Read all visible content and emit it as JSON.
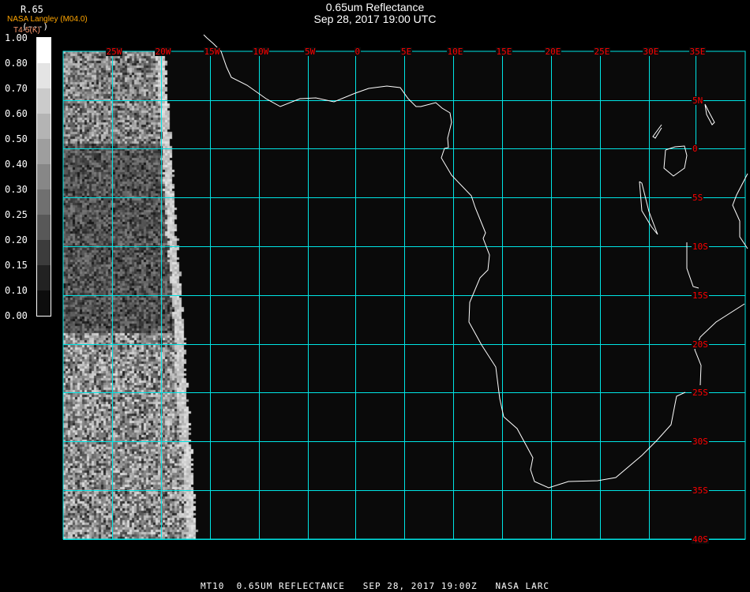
{
  "header": {
    "title": "0.65um Reflectance",
    "subtitle": "Sep 28, 2017 19:00 UTC"
  },
  "overlay_text": {
    "channel": "R.65",
    "units": "(---)",
    "producer": "NASA Langley (M04.0)",
    "secondary": "T4-5(K)"
  },
  "colorbar": {
    "labels": [
      "1.00",
      "0.80",
      "0.70",
      "0.60",
      "0.50",
      "0.40",
      "0.30",
      "0.25",
      "0.20",
      "0.15",
      "0.10",
      "0.00"
    ],
    "colors": [
      "#ffffff",
      "#e4e4e4",
      "#cbcbcb",
      "#b4b4b4",
      "#9e9e9e",
      "#878787",
      "#707070",
      "#585858",
      "#3c3c3c",
      "#222222",
      "#0d0d0d"
    ]
  },
  "map": {
    "longitude_labels": [
      "25W",
      "20W",
      "15W",
      "10W",
      "5W",
      "0",
      "5E",
      "10E",
      "15E",
      "20E",
      "25E",
      "30E",
      "35E"
    ],
    "latitude_labels": [
      "5N",
      "0",
      "5S",
      "10S",
      "15S",
      "20S",
      "25S",
      "30S",
      "35S",
      "40S"
    ],
    "grid_color": "#00e5e5",
    "label_color": "#ff0000",
    "coast_color": "#ffffff",
    "background_color": "#0a0a0a"
  },
  "footer": {
    "text": "MT10  0.65UM REFLECTANCE   SEP 28, 2017 19:00Z   NASA LARC"
  }
}
